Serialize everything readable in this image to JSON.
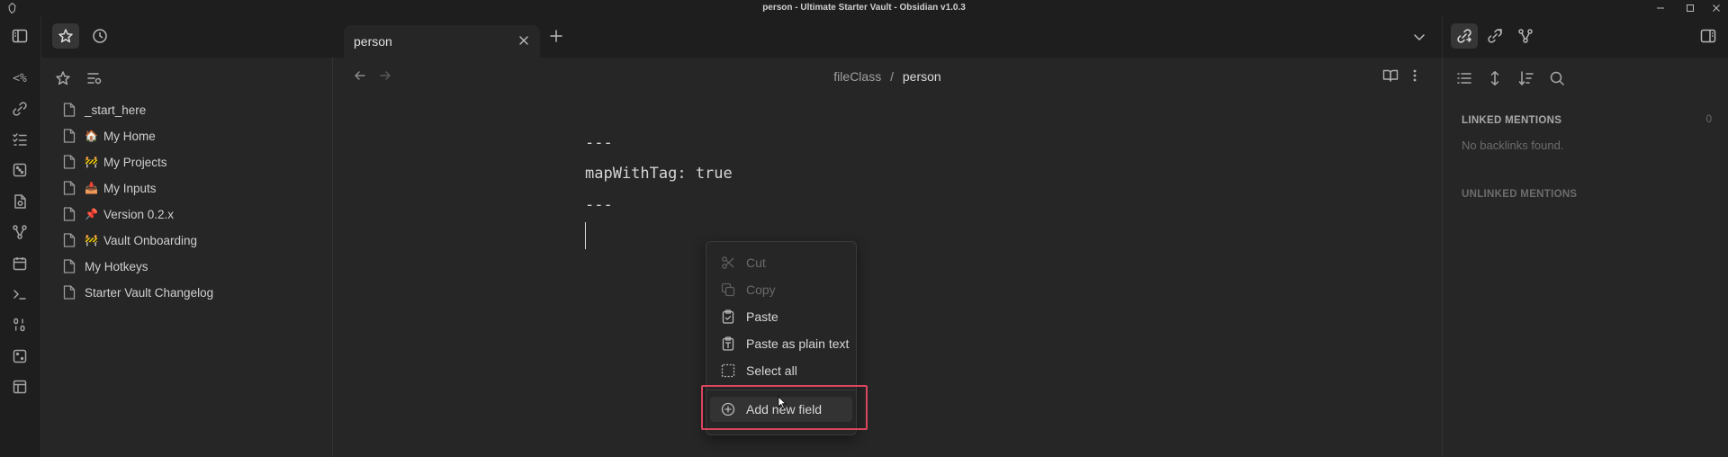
{
  "window": {
    "title": "person - Ultimate Starter Vault - Obsidian v1.0.3"
  },
  "ribbon": {
    "icons": [
      "templater-icon",
      "random-link-icon",
      "tasks-icon",
      "dice-icon",
      "file-plus-icon",
      "graph-icon",
      "calendar-icon",
      "terminal-icon",
      "binary-icon",
      "dice-alt-icon",
      "table-icon"
    ],
    "templater_glyph": "<%"
  },
  "left_top": {
    "icons": [
      "sidebar-toggle-icon",
      "star-icon",
      "clock-icon"
    ]
  },
  "sidebar": {
    "tools": [
      "star-icon",
      "list-settings-icon"
    ],
    "files": [
      {
        "emoji": "",
        "label": "_start_here"
      },
      {
        "emoji": "🏠",
        "label": "My Home"
      },
      {
        "emoji": "🚧",
        "label": "My Projects"
      },
      {
        "emoji": "📥",
        "label": "My Inputs"
      },
      {
        "emoji": "📌",
        "label": "Version 0.2.x"
      },
      {
        "emoji": "🚧",
        "label": "Vault Onboarding"
      },
      {
        "emoji": "",
        "label": "My Hotkeys"
      },
      {
        "emoji": "",
        "label": "Starter Vault Changelog"
      }
    ]
  },
  "tabs": {
    "active_label": "person",
    "new_tab_icon": "plus-icon",
    "close_icon": "close-icon",
    "list_icon": "chevron-down-icon"
  },
  "editor": {
    "breadcrumb_parent": "fileClass",
    "breadcrumb_separator": "/",
    "breadcrumb_current": "person",
    "lines": [
      "---",
      "mapWithTag: true",
      "---"
    ]
  },
  "context_menu": {
    "items": [
      {
        "label": "Cut",
        "icon": "scissors-icon",
        "disabled": true
      },
      {
        "label": "Copy",
        "icon": "copy-icon",
        "disabled": true
      },
      {
        "label": "Paste",
        "icon": "clipboard-icon",
        "disabled": false
      },
      {
        "label": "Paste as plain text",
        "icon": "clipboard-text-icon",
        "disabled": false
      },
      {
        "label": "Select all",
        "icon": "select-all-icon",
        "disabled": false
      },
      {
        "label": "Add new field",
        "icon": "plus-circle-icon",
        "disabled": false
      }
    ]
  },
  "right_panel": {
    "top_icons": [
      "backlinks-icon",
      "outgoing-links-icon",
      "graph-fork-icon",
      "right-sidebar-toggle-icon"
    ],
    "tools": [
      "list-icon",
      "expand-icon",
      "sort-icon",
      "search-icon"
    ],
    "linked_mentions_label": "LINKED MENTIONS",
    "linked_mentions_count": "0",
    "no_backlinks_text": "No backlinks found.",
    "unlinked_mentions_label": "UNLINKED MENTIONS"
  },
  "colors": {
    "highlight_border": "#d9465f",
    "background": "#1e1e1e",
    "panel": "#262626"
  }
}
